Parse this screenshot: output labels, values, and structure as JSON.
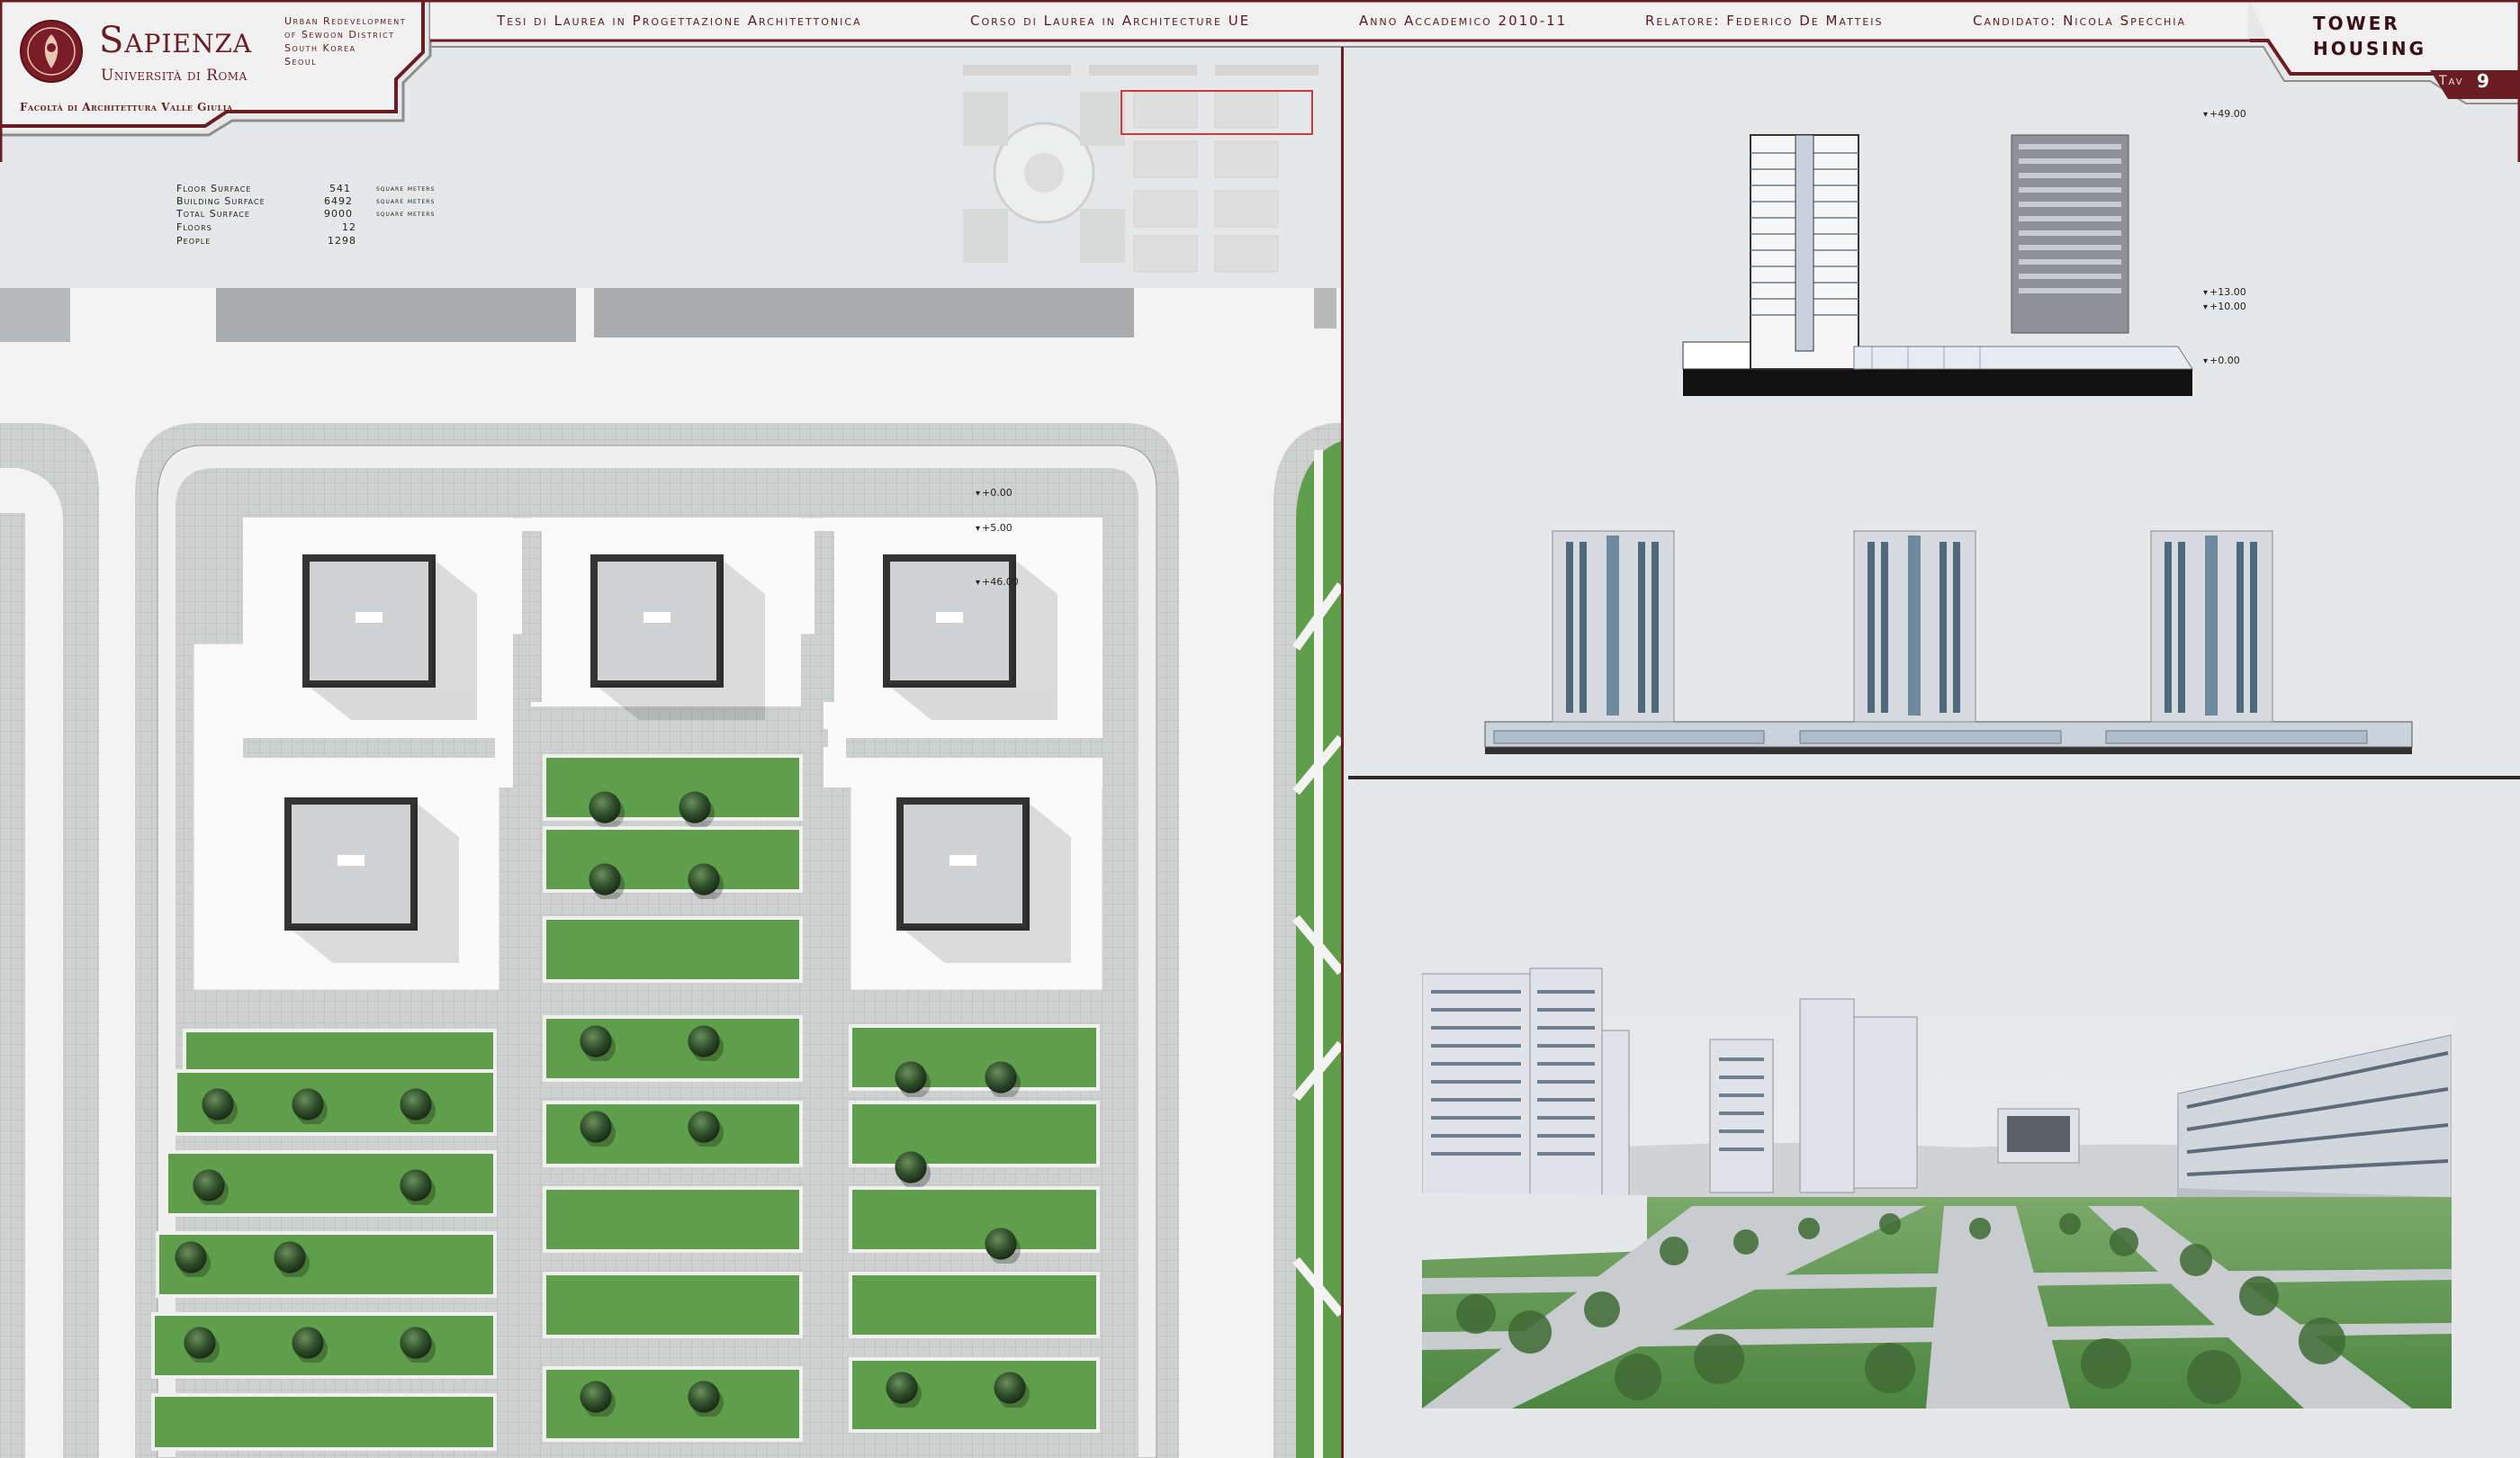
{
  "header": {
    "university": "Sapienza",
    "university_sub": "Università di Roma",
    "faculty": "Facoltà di Architettura Valle Giulia",
    "project_lines": [
      "Urban Redevelopment",
      "of Sewoon District",
      "South Korea",
      "Seoul"
    ],
    "thesis": "Tesi di Laurea in Progettazione Architettonica",
    "course": "Corso di Laurea in Architecture UE",
    "year": "Anno Accademico 2010-11",
    "advisor": "Relatore: Federico De Matteis",
    "candidate": "Candidato: Nicola Specchia",
    "title_line1": "Tower",
    "title_line2": "Housing",
    "tav_label": "Tav",
    "tav_number": "9",
    "accent_color": "#6b1d24",
    "frame_color": "#8a8a8a"
  },
  "stats": [
    {
      "label": "Floor Surface",
      "value": "541",
      "unit": "square meters"
    },
    {
      "label": "Building Surface",
      "value": "6492",
      "unit": "square meters"
    },
    {
      "label": "Total Surface",
      "value": "9000",
      "unit": "square meters"
    },
    {
      "label": "Floors",
      "value": "12",
      "unit": ""
    },
    {
      "label": "People",
      "value": "1298",
      "unit": ""
    }
  ],
  "plan_levels": [
    "+0.00",
    "+5.00",
    "+46.00"
  ],
  "section_levels": [
    "+49.00",
    "+13.00",
    "+10.00",
    "+0.00"
  ],
  "colors": {
    "grass": "#5f9e4a",
    "pavement": "#cfd0d0",
    "road": "#f4f4f4",
    "sky": "#e9ecef",
    "building": "#d7dbe0",
    "tree": "#2f5e2a"
  }
}
